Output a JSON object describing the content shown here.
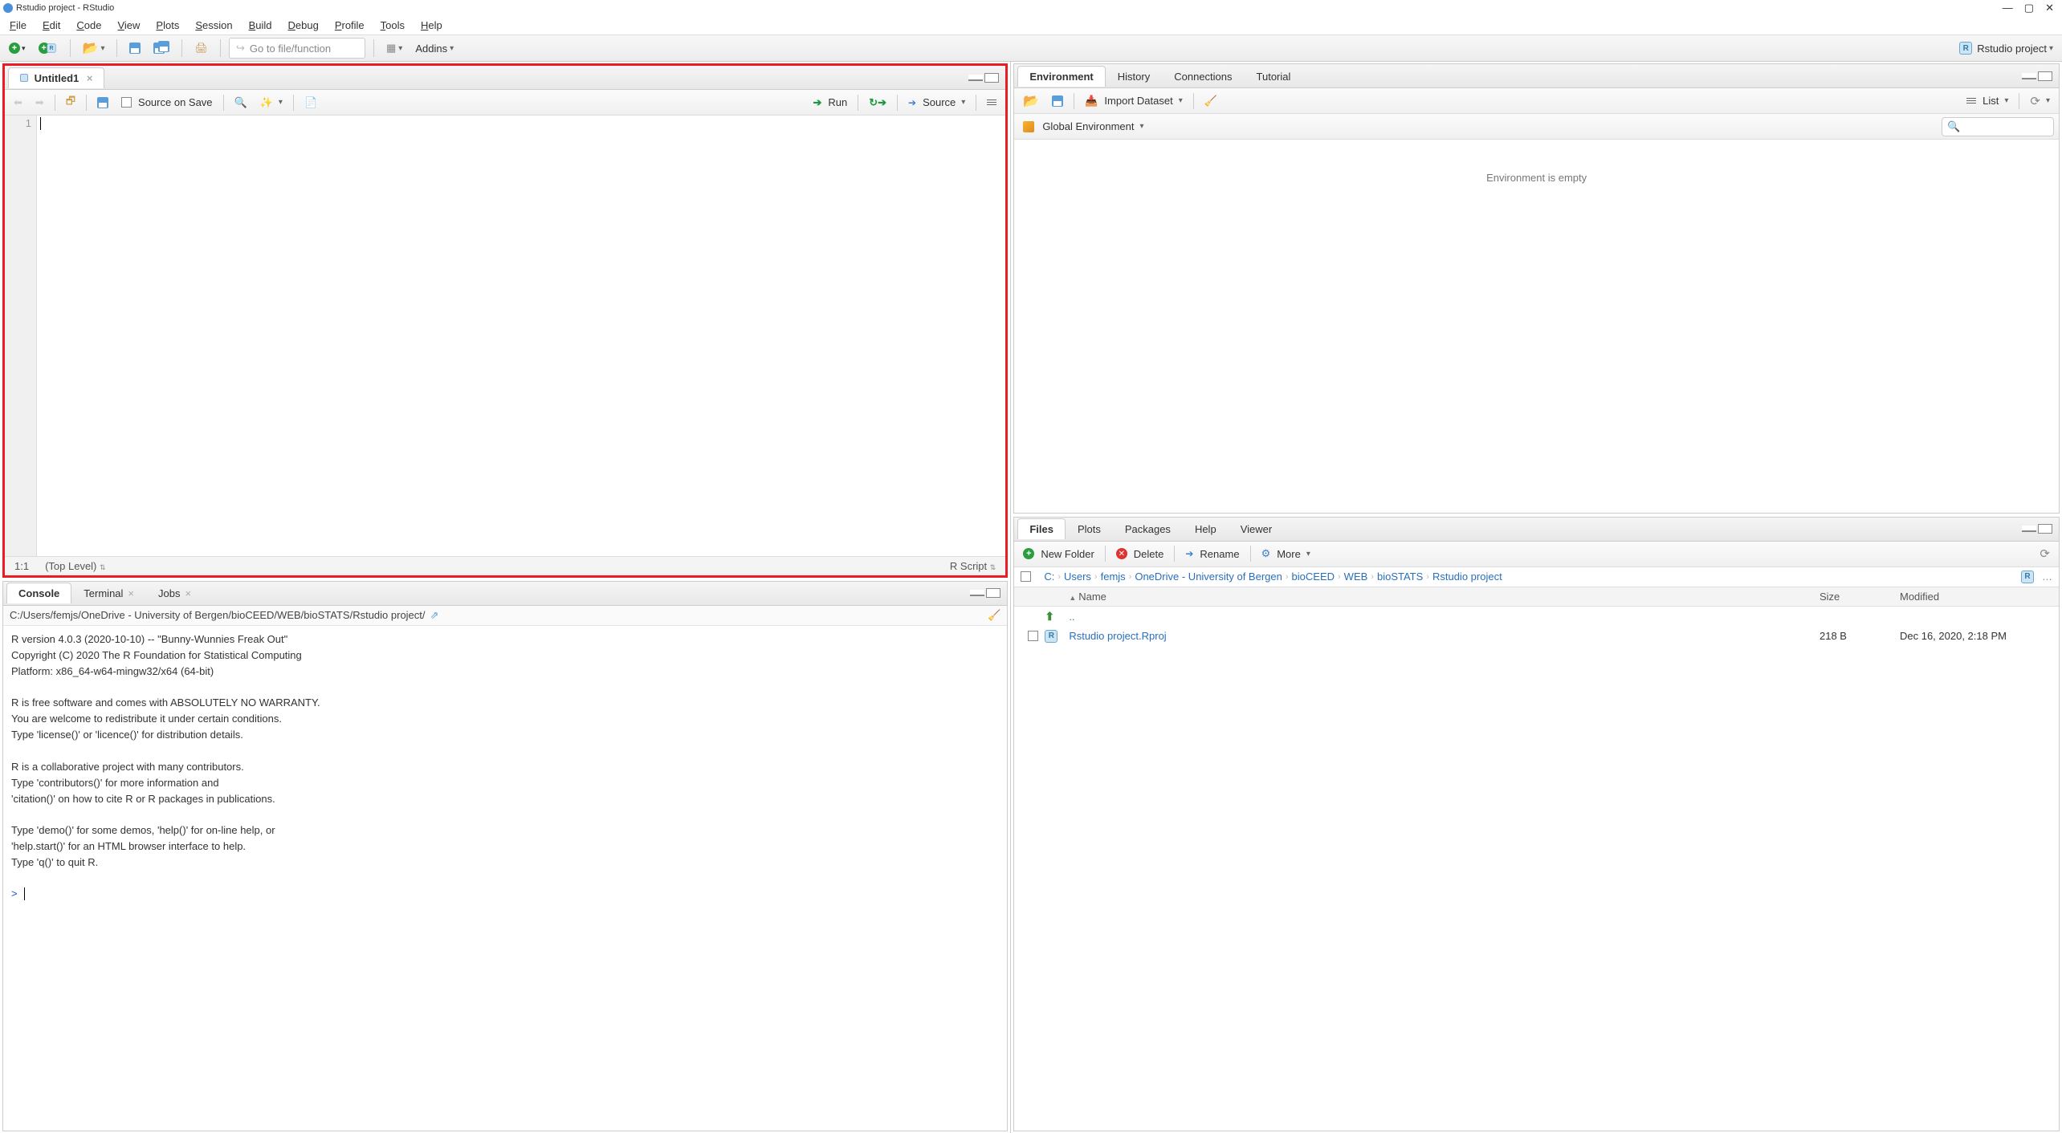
{
  "window": {
    "title": "Rstudio project - RStudio",
    "controls": {
      "min": "—",
      "max": "▢",
      "close": "✕"
    }
  },
  "menu": [
    "File",
    "Edit",
    "Code",
    "View",
    "Plots",
    "Session",
    "Build",
    "Debug",
    "Profile",
    "Tools",
    "Help"
  ],
  "main_toolbar": {
    "search_placeholder": "Go to file/function",
    "addins_label": "Addins",
    "project_label": "Rstudio project"
  },
  "source": {
    "tab_label": "Untitled1",
    "source_on_save": "Source on Save",
    "run": "Run",
    "source_btn": "Source",
    "line_no": "1",
    "status_pos": "1:1",
    "status_scope": "(Top Level)",
    "status_type": "R Script"
  },
  "console_pane": {
    "tabs": [
      "Console",
      "Terminal",
      "Jobs"
    ],
    "path": "C:/Users/femjs/OneDrive - University of Bergen/bioCEED/WEB/bioSTATS/Rstudio project/",
    "body": "R version 4.0.3 (2020-10-10) -- \"Bunny-Wunnies Freak Out\"\nCopyright (C) 2020 The R Foundation for Statistical Computing\nPlatform: x86_64-w64-mingw32/x64 (64-bit)\n\nR is free software and comes with ABSOLUTELY NO WARRANTY.\nYou are welcome to redistribute it under certain conditions.\nType 'license()' or 'licence()' for distribution details.\n\nR is a collaborative project with many contributors.\nType 'contributors()' for more information and\n'citation()' on how to cite R or R packages in publications.\n\nType 'demo()' for some demos, 'help()' for on-line help, or\n'help.start()' for an HTML browser interface to help.\nType 'q()' to quit R.\n",
    "prompt": ">"
  },
  "env_pane": {
    "tabs": [
      "Environment",
      "History",
      "Connections",
      "Tutorial"
    ],
    "import_label": "Import Dataset",
    "list_label": "List",
    "scope_label": "Global Environment",
    "empty_msg": "Environment is empty"
  },
  "files_pane": {
    "tabs": [
      "Files",
      "Plots",
      "Packages",
      "Help",
      "Viewer"
    ],
    "new_folder": "New Folder",
    "delete": "Delete",
    "rename": "Rename",
    "more": "More",
    "breadcrumb": [
      "C:",
      "Users",
      "femjs",
      "OneDrive - University of Bergen",
      "bioCEED",
      "WEB",
      "bioSTATS",
      "Rstudio project"
    ],
    "cols": {
      "name": "Name",
      "size": "Size",
      "modified": "Modified"
    },
    "up_label": "..",
    "rows": [
      {
        "name": "Rstudio project.Rproj",
        "size": "218 B",
        "modified": "Dec 16, 2020, 2:18 PM"
      }
    ]
  }
}
